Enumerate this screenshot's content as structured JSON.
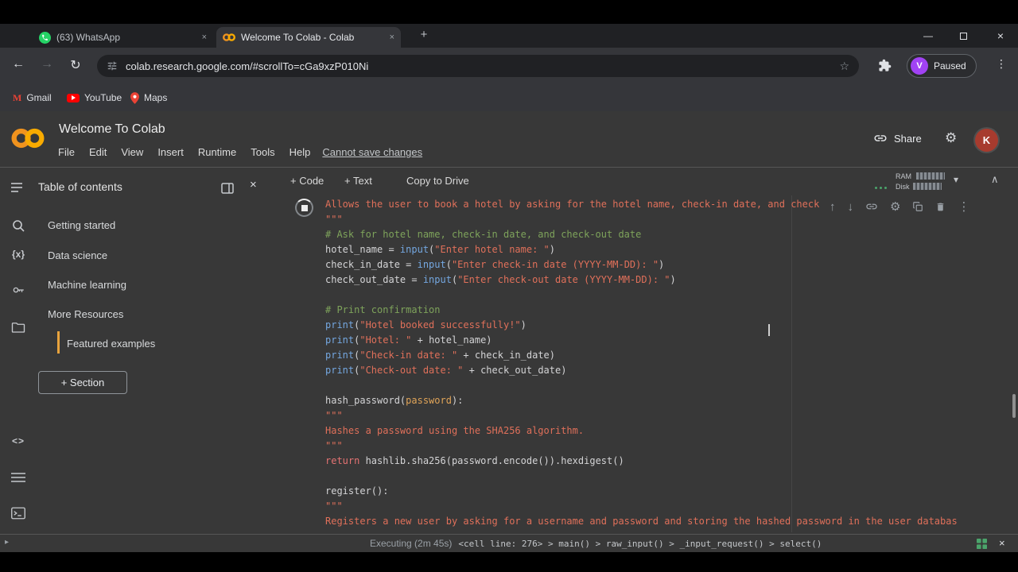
{
  "chrome": {
    "tabs": [
      {
        "title": "(63) WhatsApp"
      },
      {
        "title": "Welcome To Colab - Colab"
      }
    ],
    "url": "colab.research.google.com/#scrollTo=cGa9xzP010Ni",
    "profile_label": "Paused",
    "profile_avatar": "V",
    "bookmarks": [
      "Gmail",
      "YouTube",
      "Maps"
    ]
  },
  "header": {
    "title": "Welcome To Colab",
    "menus": [
      "File",
      "Edit",
      "View",
      "Insert",
      "Runtime",
      "Tools",
      "Help"
    ],
    "save_status": "Cannot save changes",
    "share": "Share",
    "avatar": "K"
  },
  "toolbar": {
    "add_code": "+ Code",
    "add_text": "+ Text",
    "copy_to_drive": "Copy to Drive",
    "ram": "RAM",
    "disk": "Disk"
  },
  "sidebar": {
    "title": "Table of contents",
    "items": [
      {
        "label": "Getting started"
      },
      {
        "label": "Data science"
      },
      {
        "label": "Machine learning"
      },
      {
        "label": "More Resources"
      },
      {
        "label": "Featured examples"
      }
    ],
    "section_button": "+ Section"
  },
  "statusbar": {
    "executing": "Executing (2m 45s)",
    "trace": "<cell line: 276> > main() > raw_input() > _input_request() > select()"
  },
  "icons": {
    "close": "×",
    "plus": "+",
    "minimize": "—",
    "back": "←",
    "forward": "→",
    "refresh": "↻",
    "star": "☆",
    "more_vert": "⋮",
    "up_arrow": "↑",
    "down_arrow": "↓",
    "gear": "⚙",
    "caret_down": "▾",
    "collapse": "∧",
    "play": "▸",
    "gmail": "M",
    "var": "{x}",
    "code_snippets": "<>"
  },
  "colors": {
    "colab_orange": "#F9AB00",
    "whatsapp_green": "#25D366",
    "youtube_red": "#FF0000",
    "profile_purple": "#A142F4",
    "avatar_red": "#A73B2E",
    "toc_active_indicator": "#E8A33D",
    "status_green": "#4BA46B",
    "syntax_string": "#E0705A",
    "syntax_comment": "#7EA35B",
    "syntax_builtin": "#74A7E0",
    "syntax_keyword": "#E57373",
    "syntax_param": "#E0A458"
  },
  "code": {
    "lines": [
      [
        {
          "t": "Allows the user to book a hotel by asking for the hotel name, check-in date, and check",
          "c": "s"
        }
      ],
      [
        {
          "t": "\"\"\"",
          "c": "s"
        }
      ],
      [
        {
          "t": "# Ask for hotel name, check-in date, and check-out date",
          "c": "c"
        }
      ],
      [
        {
          "t": "hotel_name = ",
          "c": "p"
        },
        {
          "t": "input",
          "c": "b"
        },
        {
          "t": "(",
          "c": "p"
        },
        {
          "t": "\"Enter hotel name: \"",
          "c": "s"
        },
        {
          "t": ")",
          "c": "p"
        }
      ],
      [
        {
          "t": "check_in_date = ",
          "c": "p"
        },
        {
          "t": "input",
          "c": "b"
        },
        {
          "t": "(",
          "c": "p"
        },
        {
          "t": "\"Enter check-in date (YYYY-MM-DD): \"",
          "c": "s"
        },
        {
          "t": ")",
          "c": "p"
        }
      ],
      [
        {
          "t": "check_out_date = ",
          "c": "p"
        },
        {
          "t": "input",
          "c": "b"
        },
        {
          "t": "(",
          "c": "p"
        },
        {
          "t": "\"Enter check-out date (YYYY-MM-DD): \"",
          "c": "s"
        },
        {
          "t": ")",
          "c": "p"
        }
      ],
      [],
      [
        {
          "t": "# Print confirmation",
          "c": "c"
        }
      ],
      [
        {
          "t": "print",
          "c": "b"
        },
        {
          "t": "(",
          "c": "p"
        },
        {
          "t": "\"Hotel booked successfully!\"",
          "c": "s"
        },
        {
          "t": ")",
          "c": "p"
        }
      ],
      [
        {
          "t": "print",
          "c": "b"
        },
        {
          "t": "(",
          "c": "p"
        },
        {
          "t": "\"Hotel: \"",
          "c": "s"
        },
        {
          "t": " + hotel_name)",
          "c": "p"
        }
      ],
      [
        {
          "t": "print",
          "c": "b"
        },
        {
          "t": "(",
          "c": "p"
        },
        {
          "t": "\"Check-in date: \"",
          "c": "s"
        },
        {
          "t": " + check_in_date)",
          "c": "p"
        }
      ],
      [
        {
          "t": "print",
          "c": "b"
        },
        {
          "t": "(",
          "c": "p"
        },
        {
          "t": "\"Check-out date: \"",
          "c": "s"
        },
        {
          "t": " + check_out_date)",
          "c": "p"
        }
      ],
      [],
      [
        {
          "t": "hash_password(",
          "c": "p"
        },
        {
          "t": "password",
          "c": "o"
        },
        {
          "t": "):",
          "c": "p"
        }
      ],
      [
        {
          "t": "\"\"\"",
          "c": "s"
        }
      ],
      [
        {
          "t": "Hashes a password using the SHA256 algorithm.",
          "c": "s"
        }
      ],
      [
        {
          "t": "\"\"\"",
          "c": "s"
        }
      ],
      [
        {
          "t": "return",
          "c": "k"
        },
        {
          "t": " hashlib.sha256(password.encode()).hexdigest()",
          "c": "p"
        }
      ],
      [],
      [
        {
          "t": "register():",
          "c": "p"
        }
      ],
      [
        {
          "t": "\"\"\"",
          "c": "s"
        }
      ],
      [
        {
          "t": "Registers a new user by asking for a username and password and storing the hashed password in the user databas",
          "c": "s"
        }
      ]
    ]
  }
}
